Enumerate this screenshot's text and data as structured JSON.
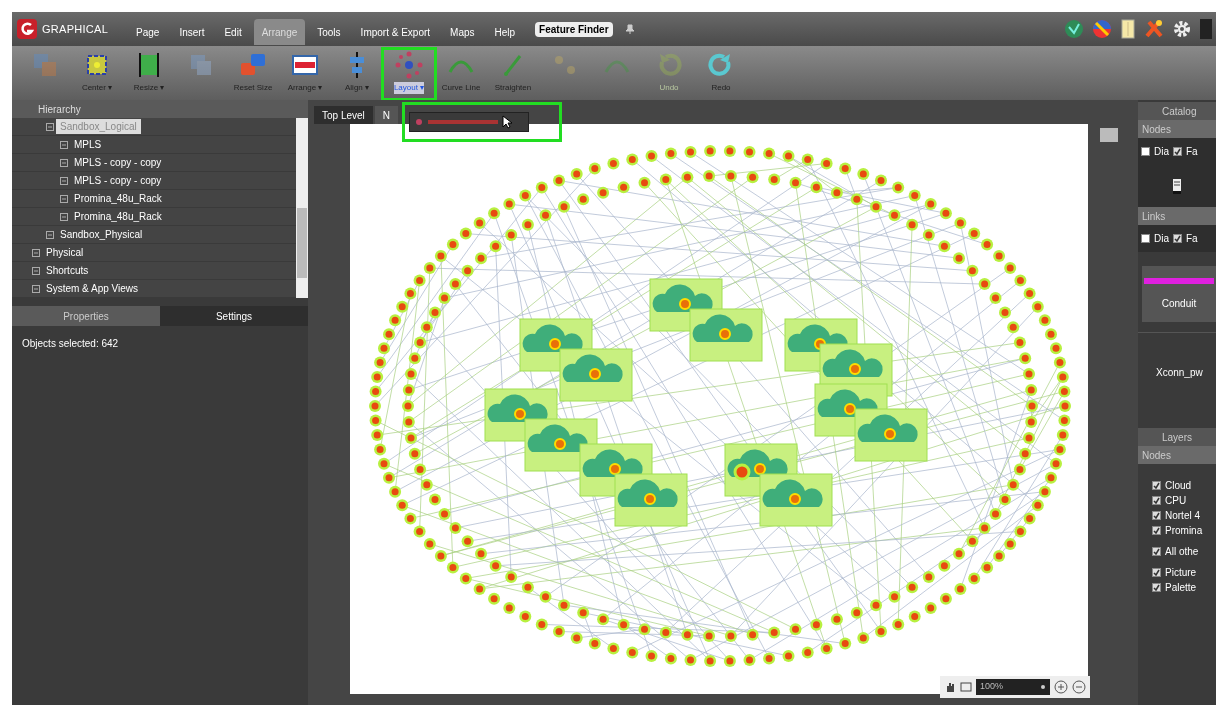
{
  "menu": [
    {
      "label": "Page",
      "selected": false
    },
    {
      "label": "Insert",
      "selected": false
    },
    {
      "label": "Edit",
      "selected": false
    },
    {
      "label": "Arrange",
      "selected": true
    },
    {
      "label": "Tools",
      "selected": false
    },
    {
      "label": "Import & Export",
      "selected": false
    },
    {
      "label": "Maps",
      "selected": false
    },
    {
      "label": "Help",
      "selected": false
    }
  ],
  "feature_finder": "Feature Finder",
  "logo": "GRAPHICAL",
  "toolbar": [
    {
      "disabled": true,
      "kind": "group"
    },
    {
      "label": "Center ▾",
      "disabled": false,
      "kind": "center"
    },
    {
      "label": "Resize ▾",
      "disabled": false,
      "kind": "resize"
    },
    {
      "disabled": true,
      "kind": "copy"
    },
    {
      "label": "Reset Size",
      "disabled": false,
      "kind": "reset"
    },
    {
      "label": "Arrange ▾",
      "disabled": false,
      "kind": "arrange"
    },
    {
      "label": "Align ▾",
      "disabled": false,
      "kind": "align"
    },
    {
      "label": "Layout ▾",
      "disabled": false,
      "kind": "layout",
      "highlighted": true
    },
    {
      "label": "Curve Line",
      "disabled": false,
      "kind": "curve"
    },
    {
      "label": "Straighten",
      "disabled": false,
      "kind": "straight"
    },
    {
      "disabled": true,
      "kind": "dots"
    },
    {
      "disabled": true,
      "kind": "curve"
    },
    {
      "label": "Undo",
      "disabled": true,
      "kind": "undo"
    },
    {
      "label": "Redo",
      "disabled": false,
      "kind": "redo"
    }
  ],
  "hierarchy": {
    "title": "Hierarchy",
    "tree": [
      {
        "label": "Sandbox_Logical",
        "selected": true,
        "children": [
          {
            "label": "MPLS",
            "selected": false
          },
          {
            "label": "MPLS - copy - copy",
            "selected": false
          },
          {
            "label": "MPLS - copy - copy",
            "selected": false
          },
          {
            "label": "Promina_48u_Rack",
            "selected": false
          },
          {
            "label": "Promina_48u_Rack",
            "selected": false
          }
        ]
      },
      {
        "label": "Sandbox_Physical",
        "selected": false
      },
      {
        "label": "Physical",
        "selected": false,
        "root": true
      },
      {
        "label": "Shortcuts",
        "selected": false,
        "root": true
      },
      {
        "label": "System & App Views",
        "selected": false,
        "root": true
      }
    ]
  },
  "bottom_tabs": [
    {
      "label": "Properties",
      "selected": true
    },
    {
      "label": "Settings",
      "selected": false
    }
  ],
  "properties_text": "Objects selected: 642",
  "canvas_tabs": [
    {
      "label": "Top Level",
      "selected": true
    },
    {
      "label": "N",
      "selected": false
    }
  ],
  "zoom": "100%",
  "catalog": {
    "title": "Catalog",
    "sections": [
      {
        "title": "Nodes",
        "checks": [
          {
            "label": "Dia",
            "checked": false
          },
          {
            "label": "Fa",
            "checked": true
          }
        ]
      },
      {
        "title": "Links",
        "checks": [
          {
            "label": "Dia",
            "checked": false
          },
          {
            "label": "Fa",
            "checked": true
          }
        ]
      }
    ],
    "conduit": "Conduit",
    "item": "Xconn_pw"
  },
  "layers": {
    "title": "Layers",
    "section": "Nodes",
    "groups": [
      [
        {
          "label": "Cloud",
          "checked": true
        },
        {
          "label": "CPU",
          "checked": true
        },
        {
          "label": "Nortel 4",
          "checked": true
        },
        {
          "label": "Promina",
          "checked": true
        }
      ],
      [
        {
          "label": "All othe",
          "checked": true
        }
      ],
      [
        {
          "label": "Picture",
          "checked": true
        },
        {
          "label": "Palette",
          "checked": true
        }
      ]
    ]
  }
}
